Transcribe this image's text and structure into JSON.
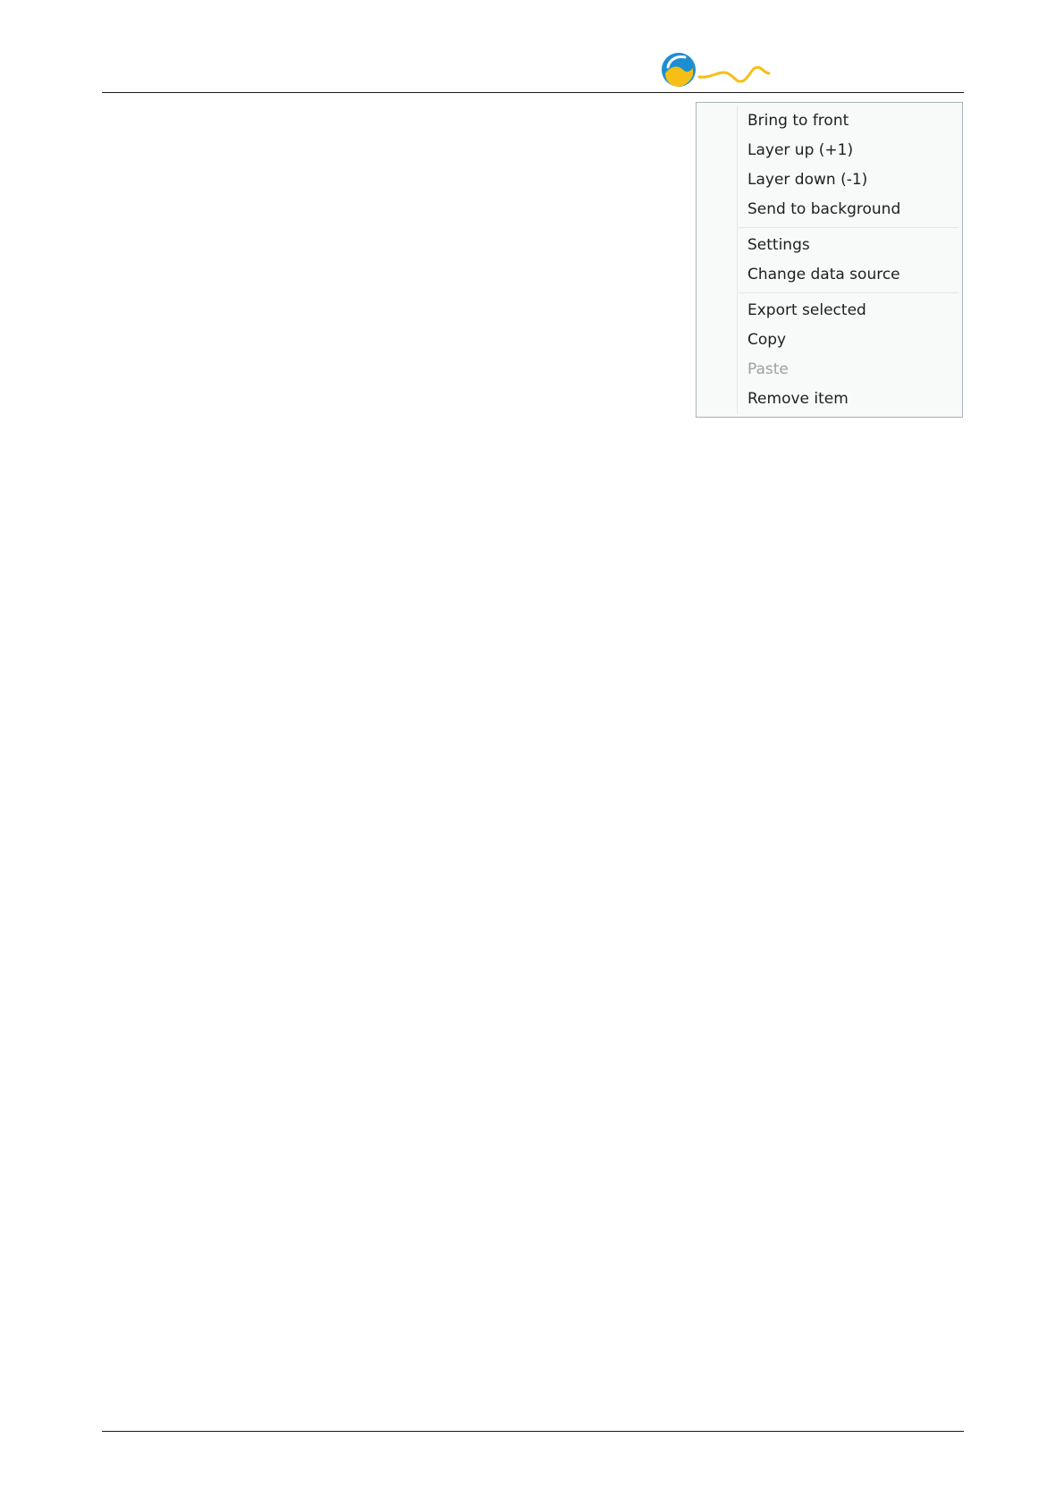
{
  "logo": {
    "icon": "company-logo-icon",
    "colors": {
      "blue": "#1b8fd2",
      "yellow": "#f5bf16"
    }
  },
  "context_menu": {
    "groups": [
      {
        "items": [
          {
            "label": "Bring to front",
            "enabled": true
          },
          {
            "label": "Layer up (+1)",
            "enabled": true
          },
          {
            "label": "Layer down (-1)",
            "enabled": true
          },
          {
            "label": "Send to background",
            "enabled": true
          }
        ]
      },
      {
        "items": [
          {
            "label": "Settings",
            "enabled": true
          },
          {
            "label": "Change data source",
            "enabled": true
          }
        ]
      },
      {
        "items": [
          {
            "label": "Export selected",
            "enabled": true
          },
          {
            "label": "Copy",
            "enabled": true
          },
          {
            "label": "Paste",
            "enabled": false
          },
          {
            "label": "Remove item",
            "enabled": true
          }
        ]
      }
    ]
  }
}
